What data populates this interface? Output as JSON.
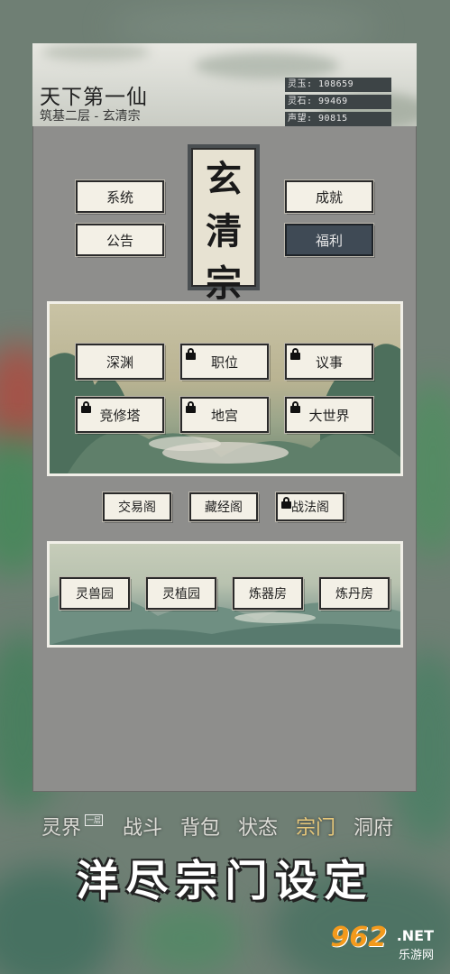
{
  "header": {
    "title": "天下第一仙",
    "subtitle": "筑基二层 - 玄清宗",
    "stats": [
      "灵玉: 108659",
      "灵石: 99469",
      "声望: 90815"
    ]
  },
  "top_buttons": {
    "system": "系统",
    "notice": "公告",
    "achievement": "成就",
    "welfare": "福利"
  },
  "sect_emblem": [
    "玄",
    "清",
    "宗"
  ],
  "scene1_buttons": [
    {
      "label": "深渊",
      "locked": false
    },
    {
      "label": "职位",
      "locked": true
    },
    {
      "label": "议事",
      "locked": true
    },
    {
      "label": "竞修塔",
      "locked": true
    },
    {
      "label": "地宫",
      "locked": true
    },
    {
      "label": "大世界",
      "locked": true
    }
  ],
  "middle_buttons": [
    {
      "label": "交易阁",
      "locked": false
    },
    {
      "label": "藏经阁",
      "locked": false
    },
    {
      "label": "战法阁",
      "locked": true
    }
  ],
  "scene2_buttons": [
    "灵兽园",
    "灵植园",
    "炼器房",
    "炼丹房"
  ],
  "bottom_menu": {
    "items": [
      "灵界",
      "战斗",
      "背包",
      "状态",
      "宗门",
      "洞府"
    ],
    "active": "宗门",
    "badge": "一层"
  },
  "promo_text": "洋尽宗门设定",
  "watermark": {
    "number": "962",
    "suffix": ".NET",
    "site": "乐游网"
  },
  "colors": {
    "active_tab": "#e7c87a",
    "stat_bg": "#3d4446",
    "welfare_bg": "#3f4a55"
  }
}
